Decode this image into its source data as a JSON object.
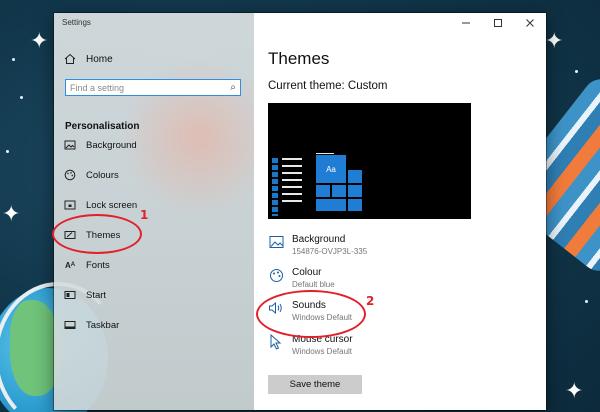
{
  "window": {
    "title": "Settings"
  },
  "nav": {
    "home_label": "Home",
    "search_placeholder": "Find a setting",
    "section_heading": "Personalisation",
    "items": [
      {
        "label": "Background",
        "icon": "image-icon"
      },
      {
        "label": "Colours",
        "icon": "palette-icon"
      },
      {
        "label": "Lock screen",
        "icon": "lock-screen-icon"
      },
      {
        "label": "Themes",
        "icon": "themes-icon"
      },
      {
        "label": "Fonts",
        "icon": "fonts-icon"
      },
      {
        "label": "Start",
        "icon": "start-icon"
      },
      {
        "label": "Taskbar",
        "icon": "taskbar-icon"
      }
    ]
  },
  "content": {
    "page_title": "Themes",
    "current_theme": "Current theme: Custom",
    "settings": [
      {
        "label": "Background",
        "value": "154876-OVJP3L-335",
        "icon": "image-icon"
      },
      {
        "label": "Colour",
        "value": "Default blue",
        "icon": "palette-icon"
      },
      {
        "label": "Sounds",
        "value": "Windows Default",
        "icon": "speaker-icon"
      },
      {
        "label": "Mouse cursor",
        "value": "Windows Default",
        "icon": "cursor-icon"
      }
    ],
    "save_button": "Save theme",
    "preview_tile_label": "Aa"
  },
  "annotations": {
    "marker_1": "1",
    "marker_2": "2",
    "color": "#e2202a"
  },
  "colors": {
    "accent": "#1f7ed4",
    "search_border": "#2e8ee0"
  }
}
